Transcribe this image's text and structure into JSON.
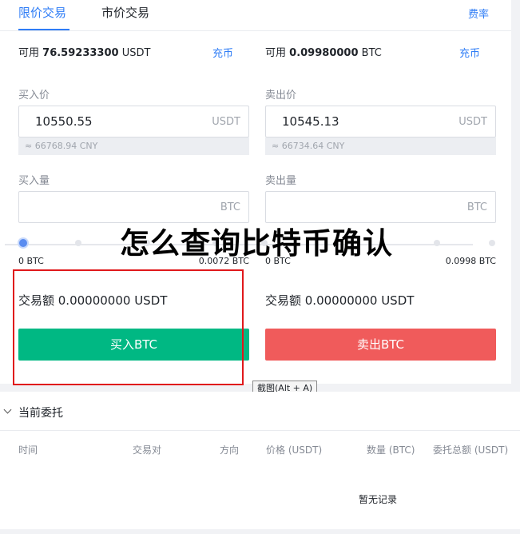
{
  "tabs": {
    "limit": "限价交易",
    "market": "市价交易",
    "fee": "费率"
  },
  "buy": {
    "available_label": "可用",
    "available_value": "76.59233300",
    "available_unit": "USDT",
    "charge": "充币",
    "price_label": "买入价",
    "price_value": "10550.55",
    "price_unit": "USDT",
    "cny": "≈ 66768.94 CNY",
    "qty_label": "买入量",
    "qty_unit": "BTC",
    "slider_min": "0 BTC",
    "slider_max": "0.0072 BTC",
    "amount": "交易额 0.00000000 USDT",
    "button": "买入BTC"
  },
  "sell": {
    "available_label": "可用",
    "available_value": "0.09980000",
    "available_unit": "BTC",
    "charge": "充币",
    "price_label": "卖出价",
    "price_value": "10545.13",
    "price_unit": "USDT",
    "cny": "≈ 66734.64 CNY",
    "qty_label": "卖出量",
    "qty_unit": "BTC",
    "slider_min": "0 BTC",
    "slider_max": "0.0998 BTC",
    "amount": "交易额 0.00000000 USDT",
    "button": "卖出BTC"
  },
  "overlay_title": "怎么查询比特币确认",
  "tooltip": "截图(Alt + A)",
  "orders": {
    "title": "当前委托",
    "columns": [
      "时间",
      "交易对",
      "方向",
      "价格 (USDT)",
      "数量 (BTC)",
      "委托总额 (USDT)"
    ],
    "empty": "暂无记录"
  },
  "colors": {
    "accent": "#2f7df6",
    "buy": "#00b883",
    "sell": "#f05b5b",
    "annotation": "#e0181b"
  }
}
